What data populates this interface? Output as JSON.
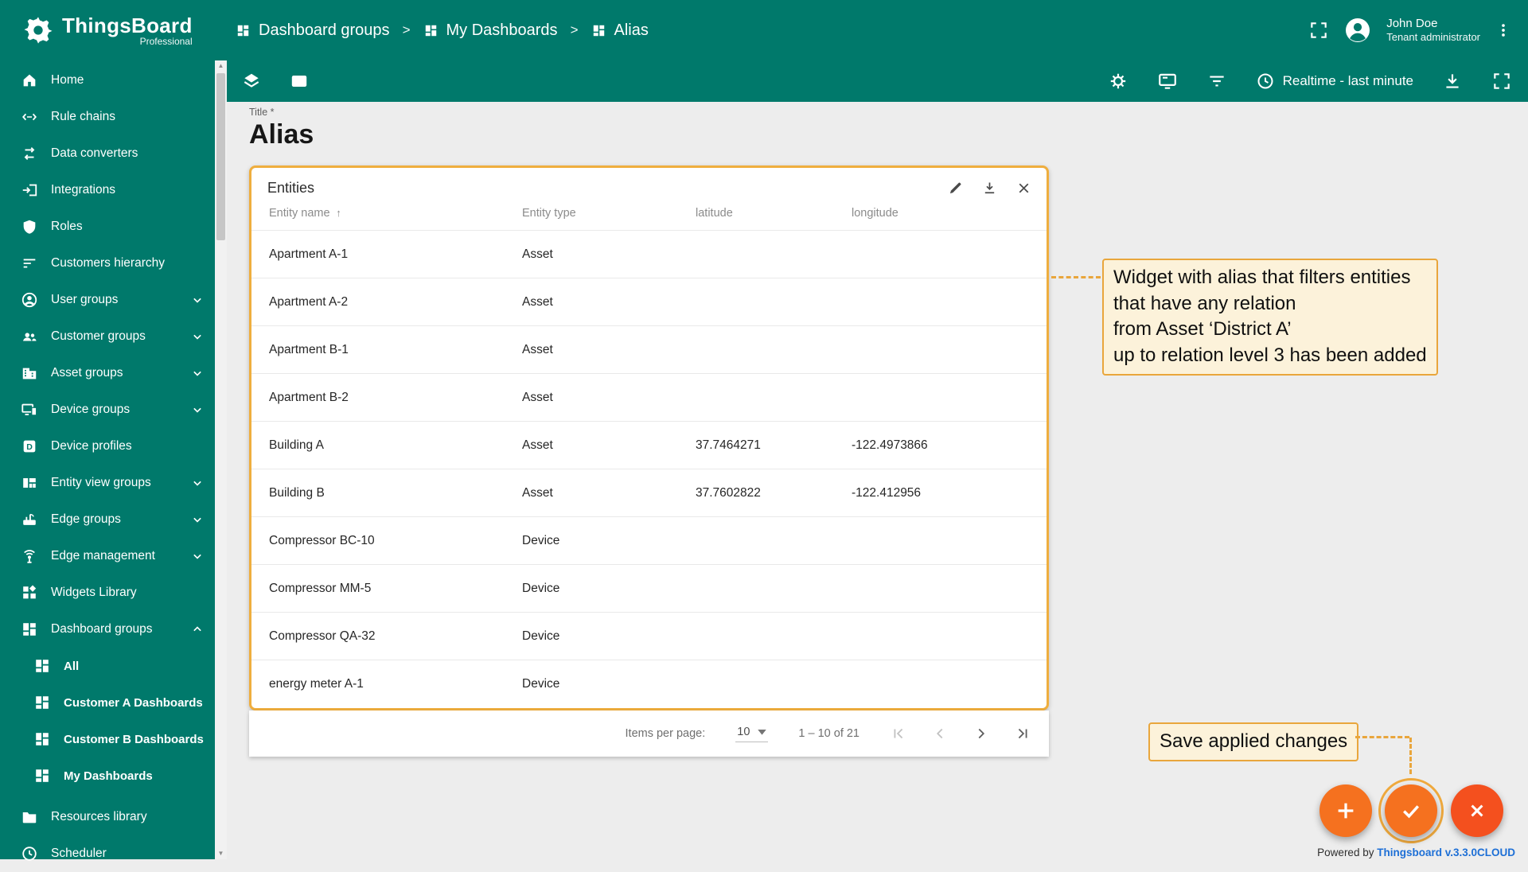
{
  "colors": {
    "brand_teal": "#00796b",
    "highlight_orange": "#efae3e",
    "annotation_border": "#e9a63c",
    "annotation_bg": "#fcf2da",
    "fab_orange": "#f5711f",
    "fab_red": "#f4501e",
    "link_blue": "#1d6fd6"
  },
  "brand": {
    "name": "ThingsBoard",
    "edition": "Professional"
  },
  "sidebar": {
    "items": [
      {
        "label": "Home"
      },
      {
        "label": "Rule chains"
      },
      {
        "label": "Data converters"
      },
      {
        "label": "Integrations"
      },
      {
        "label": "Roles"
      },
      {
        "label": "Customers hierarchy"
      },
      {
        "label": "User groups"
      },
      {
        "label": "Customer groups"
      },
      {
        "label": "Asset groups"
      },
      {
        "label": "Device groups"
      },
      {
        "label": "Device profiles"
      },
      {
        "label": "Entity view groups"
      },
      {
        "label": "Edge groups"
      },
      {
        "label": "Edge management"
      },
      {
        "label": "Widgets Library"
      },
      {
        "label": "Dashboard groups"
      },
      {
        "label": "All"
      },
      {
        "label": "Customer A Dashboards"
      },
      {
        "label": "Customer B Dashboards"
      },
      {
        "label": "My Dashboards"
      },
      {
        "label": "Resources library"
      },
      {
        "label": "Scheduler"
      }
    ]
  },
  "header": {
    "breadcrumbs": [
      "Dashboard groups",
      "My Dashboards",
      "Alias"
    ],
    "user": {
      "name": "John Doe",
      "role": "Tenant administrator"
    }
  },
  "toolbar": {
    "timewindow": "Realtime - last minute"
  },
  "page": {
    "title_label": "Title *",
    "title": "Alias"
  },
  "widget": {
    "title": "Entities",
    "columns": [
      "Entity name",
      "Entity type",
      "latitude",
      "longitude"
    ],
    "rows": [
      [
        "Apartment A-1",
        "Asset",
        "",
        ""
      ],
      [
        "Apartment A-2",
        "Asset",
        "",
        ""
      ],
      [
        "Apartment B-1",
        "Asset",
        "",
        ""
      ],
      [
        "Apartment B-2",
        "Asset",
        "",
        ""
      ],
      [
        "Building A",
        "Asset",
        "37.7464271",
        "-122.4973866"
      ],
      [
        "Building B",
        "Asset",
        "37.7602822",
        "-122.412956"
      ],
      [
        "Compressor BC-10",
        "Device",
        "",
        ""
      ],
      [
        "Compressor MM-5",
        "Device",
        "",
        ""
      ],
      [
        "Compressor QA-32",
        "Device",
        "",
        ""
      ],
      [
        "energy meter A-1",
        "Device",
        "",
        ""
      ]
    ]
  },
  "pagination": {
    "label": "Items per page:",
    "per_page": "10",
    "range": "1 – 10 of 21"
  },
  "annotations": {
    "alias_note": "Widget with alias that filters entities\nthat have any relation\nfrom Asset ‘District A’\nup to relation level 3 has been added",
    "save_note": "Save applied changes"
  },
  "footer": {
    "powered_by": "Powered by ",
    "version": "Thingsboard v.3.3.0CLOUD"
  }
}
